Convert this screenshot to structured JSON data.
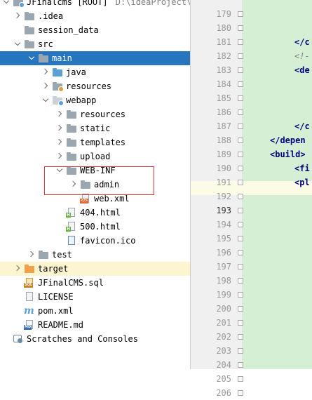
{
  "tree": {
    "root": {
      "name": "JFinalcms [ROOT]",
      "path": "D:\\ideaProject\\J"
    },
    "items": [
      {
        "label": "JFinalcms [ROOT]",
        "path": "D:\\ideaProject\\J",
        "depth": 0,
        "arrow": "down",
        "icon": "folder-module"
      },
      {
        "label": ".idea",
        "depth": 1,
        "arrow": "right",
        "icon": "folder"
      },
      {
        "label": "session_data",
        "depth": 1,
        "arrow": "none",
        "icon": "folder"
      },
      {
        "label": "src",
        "depth": 1,
        "arrow": "down",
        "icon": "folder"
      },
      {
        "label": "main",
        "depth": 2,
        "arrow": "down",
        "icon": "folder",
        "selected": true
      },
      {
        "label": "java",
        "depth": 3,
        "arrow": "right",
        "icon": "folder-blue"
      },
      {
        "label": "resources",
        "depth": 3,
        "arrow": "right",
        "icon": "folder-resources"
      },
      {
        "label": "webapp",
        "depth": 3,
        "arrow": "down",
        "icon": "folder-web"
      },
      {
        "label": "resources",
        "depth": 4,
        "arrow": "right",
        "icon": "folder"
      },
      {
        "label": "static",
        "depth": 4,
        "arrow": "right",
        "icon": "folder"
      },
      {
        "label": "templates",
        "depth": 4,
        "arrow": "right",
        "icon": "folder"
      },
      {
        "label": "upload",
        "depth": 4,
        "arrow": "right",
        "icon": "folder"
      },
      {
        "label": "WEB-INF",
        "depth": 4,
        "arrow": "down",
        "icon": "folder"
      },
      {
        "label": "admin",
        "depth": 5,
        "arrow": "right",
        "icon": "folder"
      },
      {
        "label": "web.xml",
        "depth": 5,
        "arrow": "none",
        "icon": "xml-file"
      },
      {
        "label": "404.html",
        "depth": 4,
        "arrow": "none",
        "icon": "html-file"
      },
      {
        "label": "500.html",
        "depth": 4,
        "arrow": "none",
        "icon": "html-file"
      },
      {
        "label": "favicon.ico",
        "depth": 4,
        "arrow": "none",
        "icon": "image-file"
      },
      {
        "label": "test",
        "depth": 2,
        "arrow": "right",
        "icon": "folder"
      },
      {
        "label": "target",
        "depth": 1,
        "arrow": "right",
        "icon": "folder-excluded",
        "highlight": true
      },
      {
        "label": "JFinalCMS.sql",
        "depth": 1,
        "arrow": "none",
        "icon": "sql-file"
      },
      {
        "label": "LICENSE",
        "depth": 1,
        "arrow": "none",
        "icon": "text-file"
      },
      {
        "label": "pom.xml",
        "depth": 1,
        "arrow": "none",
        "icon": "maven-file"
      },
      {
        "label": "README.md",
        "depth": 1,
        "arrow": "none",
        "icon": "markdown-file"
      },
      {
        "label": "Scratches and Consoles",
        "depth": 0,
        "arrow": "none",
        "icon": "scratches"
      }
    ]
  },
  "editor": {
    "line_numbers": [
      "179",
      "180",
      "181",
      "182",
      "183",
      "184",
      "185",
      "186",
      "187",
      "188",
      "189",
      "190",
      "191",
      "192",
      "193",
      "194",
      "195",
      "196",
      "197",
      "198",
      "199",
      "200",
      "201",
      "202",
      "203",
      "204",
      "205",
      "206"
    ],
    "current_line": "193",
    "code_lines": [
      {
        "line": "181",
        "text": "</c"
      },
      {
        "line": "182",
        "text": "<!-",
        "comment": true
      },
      {
        "line": "183",
        "text": "<de"
      },
      {
        "line": "187",
        "text": "</c"
      },
      {
        "line": "188",
        "text": "</depen"
      },
      {
        "line": "189",
        "text": "<build>"
      },
      {
        "line": "190",
        "text": "<fi"
      },
      {
        "line": "191",
        "text": "<pl"
      }
    ]
  }
}
